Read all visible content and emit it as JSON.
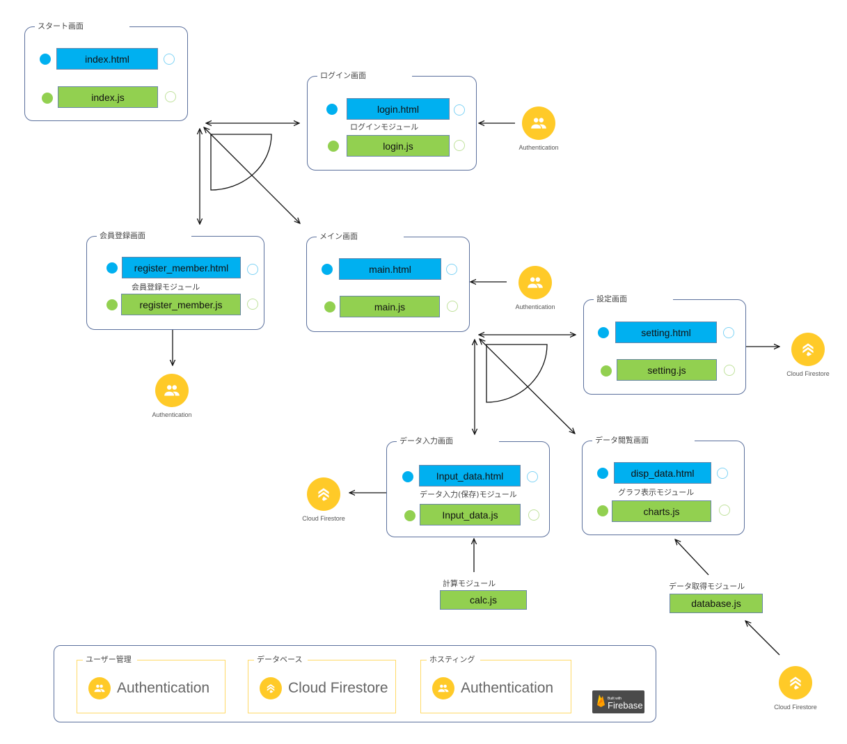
{
  "colors": {
    "html_file": "#00b0f0",
    "js_file": "#92d050",
    "screen_border": "#5a6f9c",
    "service_icon": "#ffca28",
    "legend_box_border": "#ffd966"
  },
  "screens": {
    "start": {
      "title": "スタート画面",
      "html": "index.html",
      "js": "index.js",
      "module": ""
    },
    "login": {
      "title": "ログイン画面",
      "html": "login.html",
      "js": "login.js",
      "module": "ログインモジュール"
    },
    "register": {
      "title": "会員登録画面",
      "html": "register_member.html",
      "js": "register_member.js",
      "module": "会員登録モジュール"
    },
    "main": {
      "title": "メイン画面",
      "html": "main.html",
      "js": "main.js",
      "module": ""
    },
    "setting": {
      "title": "設定画面",
      "html": "setting.html",
      "js": "setting.js",
      "module": ""
    },
    "input": {
      "title": "データ入力画面",
      "html": "Input_data.html",
      "js": "Input_data.js",
      "module": "データ入力(保存)モジュール"
    },
    "disp": {
      "title": "データ閲覧画面",
      "html": "disp_data.html",
      "js": "charts.js",
      "module": "グラフ表示モジュール"
    }
  },
  "standalone_modules": {
    "calc": {
      "label": "計算モジュール",
      "file": "calc.js"
    },
    "database": {
      "label": "データ取得モジュール",
      "file": "database.js"
    }
  },
  "services": {
    "auth_login": {
      "icon": "authentication-icon",
      "label": "Authentication"
    },
    "auth_main": {
      "icon": "authentication-icon",
      "label": "Authentication"
    },
    "auth_register": {
      "icon": "authentication-icon",
      "label": "Authentication"
    },
    "firestore_setting": {
      "icon": "cloud-firestore-icon",
      "label": "Cloud Firestore"
    },
    "firestore_input": {
      "icon": "cloud-firestore-icon",
      "label": "Cloud Firestore"
    },
    "firestore_database": {
      "icon": "cloud-firestore-icon",
      "label": "Cloud Firestore"
    }
  },
  "legend": {
    "boxes": [
      {
        "title": "ユーザー管理",
        "icon": "authentication-icon",
        "name": "Authentication"
      },
      {
        "title": "データベース",
        "icon": "cloud-firestore-icon",
        "name": "Cloud Firestore"
      },
      {
        "title": "ホスティング",
        "icon": "authentication-icon",
        "name": "Authentication"
      }
    ],
    "badge": {
      "small": "Built with",
      "big": "Firebase"
    }
  }
}
